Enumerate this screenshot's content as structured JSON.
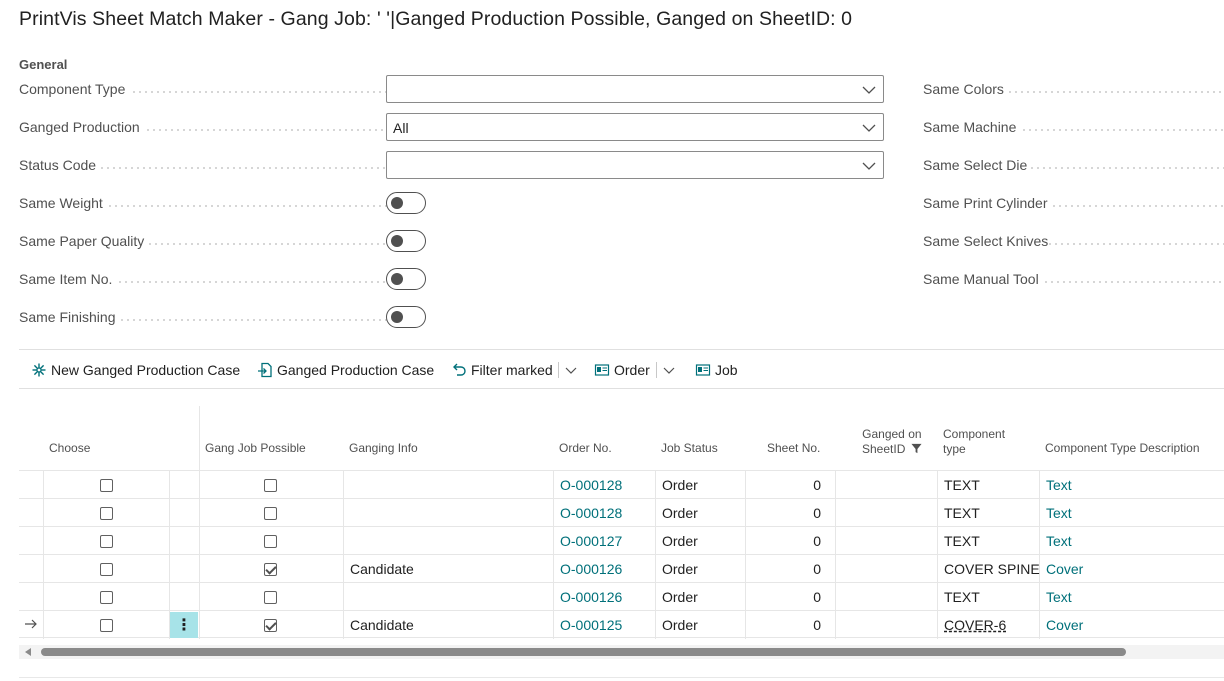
{
  "page": {
    "title": "PrintVis Sheet Match Maker - Gang Job: ' '|Ganged Production Possible, Ganged on SheetID: 0"
  },
  "general": {
    "caption": "General",
    "left_fields": [
      {
        "label": "Component Type",
        "kind": "select",
        "value": ""
      },
      {
        "label": "Ganged Production",
        "kind": "select",
        "value": "All"
      },
      {
        "label": "Status Code",
        "kind": "select",
        "value": ""
      },
      {
        "label": "Same Weight",
        "kind": "toggle",
        "value": "off"
      },
      {
        "label": "Same Paper Quality",
        "kind": "toggle",
        "value": "off"
      },
      {
        "label": "Same Item No.",
        "kind": "toggle",
        "value": "off"
      },
      {
        "label": "Same Finishing",
        "kind": "toggle",
        "value": "off"
      }
    ],
    "right_fields": [
      {
        "label": "Same Colors"
      },
      {
        "label": "Same Machine"
      },
      {
        "label": "Same Select Die"
      },
      {
        "label": "Same Print Cylinder"
      },
      {
        "label": "Same Select Knives"
      },
      {
        "label": "Same Manual Tool"
      }
    ]
  },
  "toolbar": {
    "new_case": "New Ganged Production Case",
    "case": "Ganged Production Case",
    "filter_marked": "Filter marked",
    "order": "Order",
    "job": "Job"
  },
  "grid": {
    "headers": {
      "choose": "Choose",
      "gang_job_possible": "Gang Job Possible",
      "ganging_info": "Ganging Info",
      "order_no": "Order No.",
      "job_status": "Job Status",
      "sheet_no": "Sheet No.",
      "ganged_on_1": "Ganged on",
      "ganged_on_2": "SheetID",
      "component_type_1": "Component",
      "component_type_2": "type",
      "component_type_desc": "Component Type Description"
    },
    "rows": [
      {
        "choose": false,
        "gang_possible": false,
        "info": "",
        "order_no": "O-000128",
        "status": "Order",
        "sheet_no": "0",
        "ganged_on": "",
        "component_type": "TEXT",
        "desc": "Text"
      },
      {
        "choose": false,
        "gang_possible": false,
        "info": "",
        "order_no": "O-000128",
        "status": "Order",
        "sheet_no": "0",
        "ganged_on": "",
        "component_type": "TEXT",
        "desc": "Text"
      },
      {
        "choose": false,
        "gang_possible": false,
        "info": "",
        "order_no": "O-000127",
        "status": "Order",
        "sheet_no": "0",
        "ganged_on": "",
        "component_type": "TEXT",
        "desc": "Text"
      },
      {
        "choose": false,
        "gang_possible": true,
        "info": "Candidate",
        "order_no": "O-000126",
        "status": "Order",
        "sheet_no": "0",
        "ganged_on": "",
        "component_type": "COVER SPINE",
        "desc": "Cover"
      },
      {
        "choose": false,
        "gang_possible": false,
        "info": "",
        "order_no": "O-000126",
        "status": "Order",
        "sheet_no": "0",
        "ganged_on": "",
        "component_type": "TEXT",
        "desc": "Text"
      },
      {
        "choose": false,
        "gang_possible": true,
        "info": "Candidate",
        "order_no": "O-000125",
        "status": "Order",
        "sheet_no": "0",
        "ganged_on": "",
        "component_type": "COVER-6",
        "desc": "Cover",
        "selected": true
      }
    ]
  },
  "colors": {
    "link": "#00707a",
    "selected_action": "#a7e3e8",
    "text": "#212121",
    "label": "#505050"
  }
}
